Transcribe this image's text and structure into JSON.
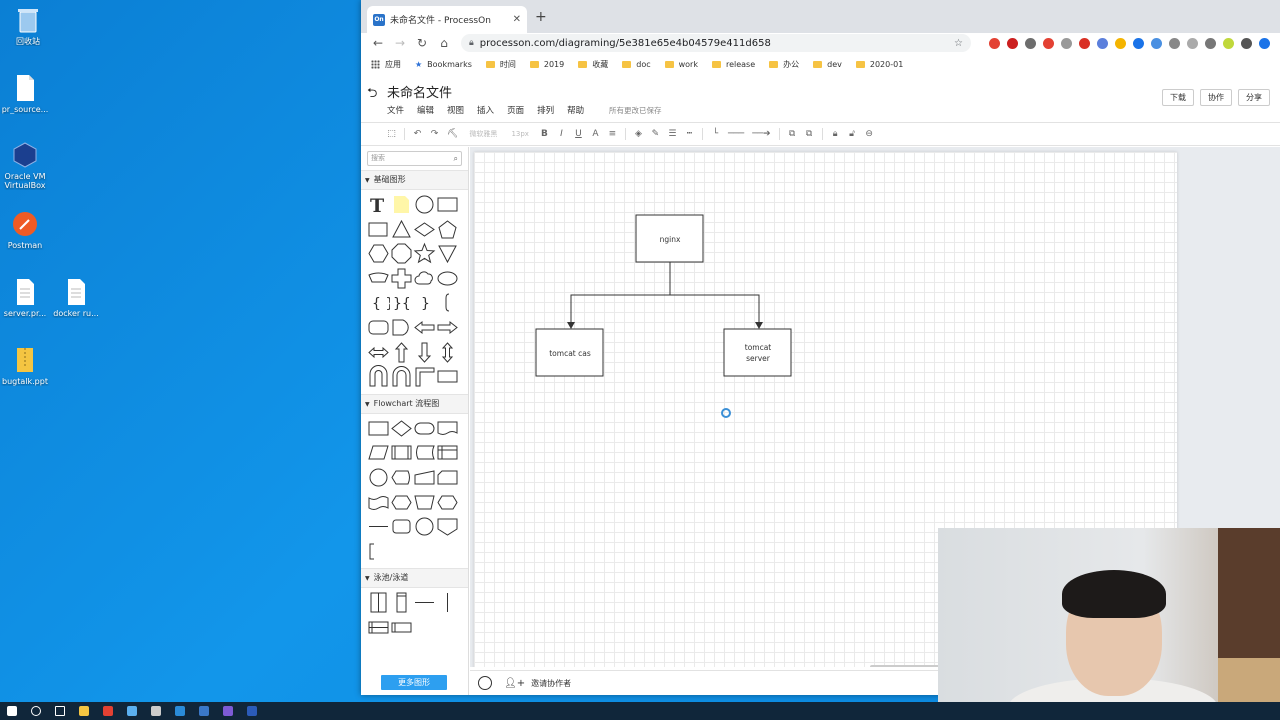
{
  "desktop": {
    "icons": [
      {
        "label": "回收站",
        "kind": "recycle-bin",
        "color": "#7fb8e8"
      },
      {
        "label": "pr_source...",
        "kind": "file",
        "color": "#ffffff"
      },
      {
        "label": "Oracle VM VirtualBox",
        "kind": "virtualbox",
        "color": "#1b3f8f"
      },
      {
        "label": "Postman",
        "kind": "postman",
        "color": "#ef5b25"
      },
      {
        "label": "server.pr...",
        "kind": "file",
        "color": "#ffffff"
      },
      {
        "label": "docker ru...",
        "kind": "file",
        "color": "#ffffff"
      },
      {
        "label": "bugtalk.ppt",
        "kind": "zip",
        "color": "#f4c542"
      }
    ]
  },
  "browser": {
    "tab_title": "未命名文件 - ProcessOn",
    "favicon_text": "On",
    "url": "processon.com/diagraming/5e381e65e4b04579e411d658",
    "bookmarks": [
      "应用",
      "Bookmarks",
      "时间",
      "2019",
      "收藏",
      "doc",
      "work",
      "release",
      "办公",
      "dev",
      "2020-01"
    ],
    "extension_colors": [
      "#e34133",
      "#cc1f1f",
      "#6d6d6d",
      "#e34133",
      "#999999",
      "#d93025",
      "#5b7fdc",
      "#f4b400",
      "#1a73e8",
      "#4a90e2",
      "#888888",
      "#aaaaaa",
      "#777777",
      "#c0d83b",
      "#555555",
      "#1a73e8"
    ]
  },
  "app": {
    "doc_title": "未命名文件",
    "menu": [
      "文件",
      "编辑",
      "视图",
      "插入",
      "页面",
      "排列",
      "帮助"
    ],
    "save_status": "所有更改已保存",
    "buttons": {
      "download": "下载",
      "collaborate": "协作",
      "share": "分享"
    },
    "toolbar": {
      "font_family": "微软雅黑",
      "font_size": "13px"
    },
    "panel": {
      "search_placeholder": "搜索",
      "section_basic": "基础图形",
      "section_flowchart": "Flowchart 流程图",
      "section_swimlane": "泳池/泳道",
      "more_shapes": "更多图形"
    },
    "invite": "邀请协作者"
  },
  "diagram": {
    "nodes": {
      "nginx": "nginx",
      "cas": "tomcat cas",
      "server_line1": "tomcat",
      "server_line2": "server"
    },
    "stroke_color": "#333333"
  },
  "taskbar": {
    "apps": [
      "start",
      "search",
      "task-view",
      "explorer",
      "chrome",
      "pen",
      "terminal",
      "vscode",
      "browser",
      "obs",
      "word"
    ]
  }
}
